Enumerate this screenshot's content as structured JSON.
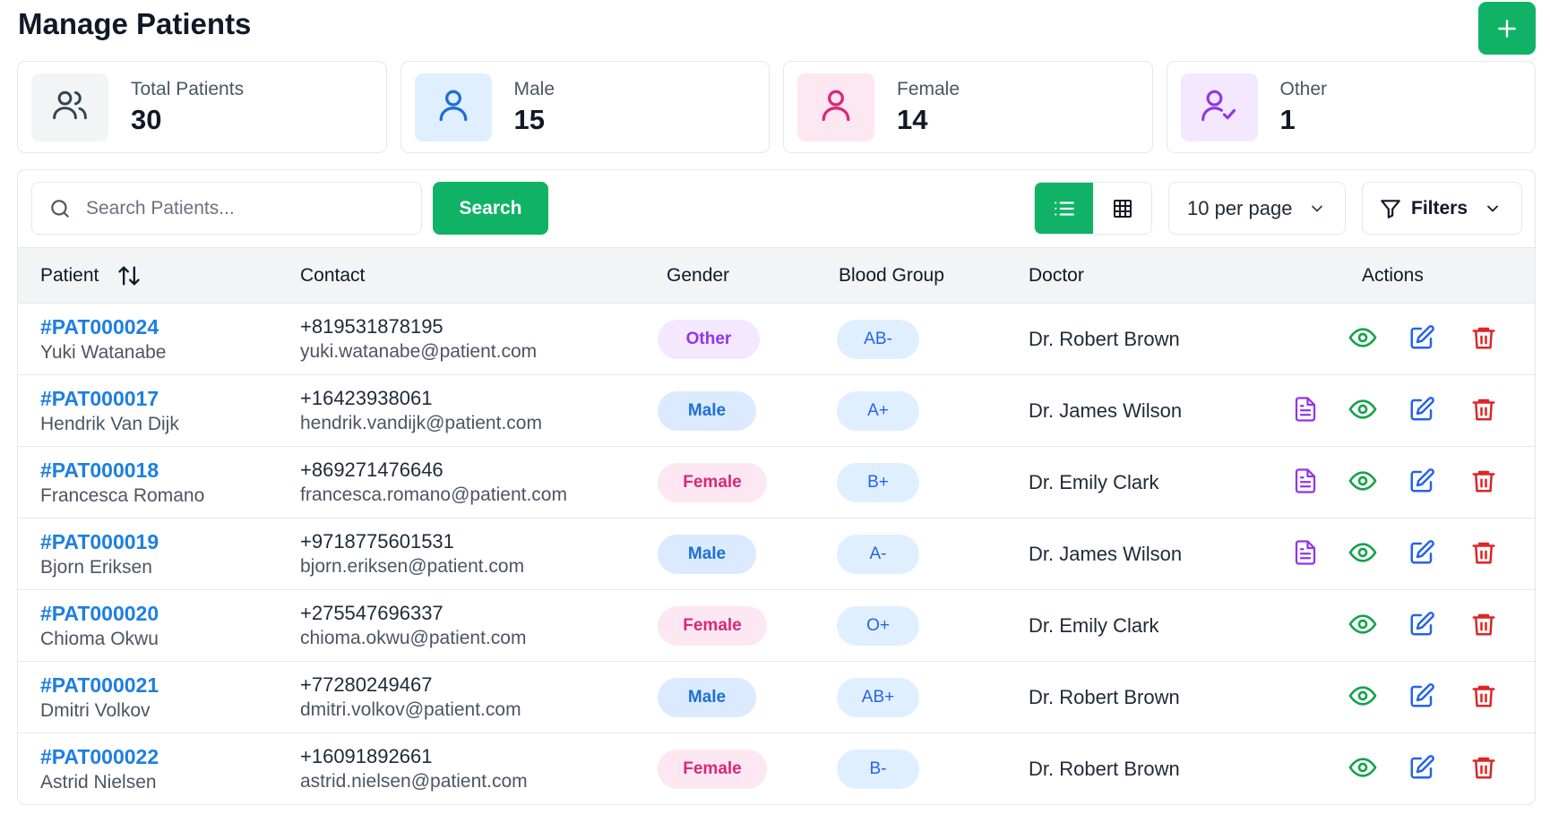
{
  "page": {
    "title": "Manage Patients",
    "add_icon": "plus-icon"
  },
  "stats": [
    {
      "label": "Total Patients",
      "value": "30",
      "icon": "users-icon",
      "bg": "#f3f4f6",
      "color": "#374151"
    },
    {
      "label": "Male",
      "value": "15",
      "icon": "user-icon",
      "bg": "#e0efff",
      "color": "#1d6fd6"
    },
    {
      "label": "Female",
      "value": "14",
      "icon": "user-icon",
      "bg": "#fde7f0",
      "color": "#db2777"
    },
    {
      "label": "Other",
      "value": "1",
      "icon": "user-check-icon",
      "bg": "#f3e8ff",
      "color": "#9333ea"
    }
  ],
  "toolbar": {
    "search_placeholder": "Search Patients...",
    "search_button": "Search",
    "per_page": "10 per page",
    "filters": "Filters"
  },
  "table": {
    "headers": {
      "patient": "Patient",
      "contact": "Contact",
      "gender": "Gender",
      "blood": "Blood Group",
      "doctor": "Doctor",
      "actions": "Actions"
    },
    "rows": [
      {
        "id": "#PAT000024",
        "name": "Yuki Watanabe",
        "phone": "+819531878195",
        "email": "yuki.watanabe@patient.com",
        "gender": "Other",
        "blood": "AB-",
        "doctor": "Dr. Robert Brown",
        "has_doc": false
      },
      {
        "id": "#PAT000017",
        "name": "Hendrik Van Dijk",
        "phone": "+16423938061",
        "email": "hendrik.vandijk@patient.com",
        "gender": "Male",
        "blood": "A+",
        "doctor": "Dr. James Wilson",
        "has_doc": true
      },
      {
        "id": "#PAT000018",
        "name": "Francesca Romano",
        "phone": "+869271476646",
        "email": "francesca.romano@patient.com",
        "gender": "Female",
        "blood": "B+",
        "doctor": "Dr. Emily Clark",
        "has_doc": true
      },
      {
        "id": "#PAT000019",
        "name": "Bjorn Eriksen",
        "phone": "+9718775601531",
        "email": "bjorn.eriksen@patient.com",
        "gender": "Male",
        "blood": "A-",
        "doctor": "Dr. James Wilson",
        "has_doc": true
      },
      {
        "id": "#PAT000020",
        "name": "Chioma Okwu",
        "phone": "+275547696337",
        "email": "chioma.okwu@patient.com",
        "gender": "Female",
        "blood": "O+",
        "doctor": "Dr. Emily Clark",
        "has_doc": false
      },
      {
        "id": "#PAT000021",
        "name": "Dmitri Volkov",
        "phone": "+77280249467",
        "email": "dmitri.volkov@patient.com",
        "gender": "Male",
        "blood": "AB+",
        "doctor": "Dr. Robert Brown",
        "has_doc": false
      },
      {
        "id": "#PAT000022",
        "name": "Astrid Nielsen",
        "phone": "+16091892661",
        "email": "astrid.nielsen@patient.com",
        "gender": "Female",
        "blood": "B-",
        "doctor": "Dr. Robert Brown",
        "has_doc": false
      }
    ]
  },
  "colors": {
    "accent": "#10b366",
    "link": "#1d7fe0",
    "view": "#16a34a",
    "edit": "#2563eb",
    "delete": "#dc2626",
    "doc": "#9333ea"
  }
}
